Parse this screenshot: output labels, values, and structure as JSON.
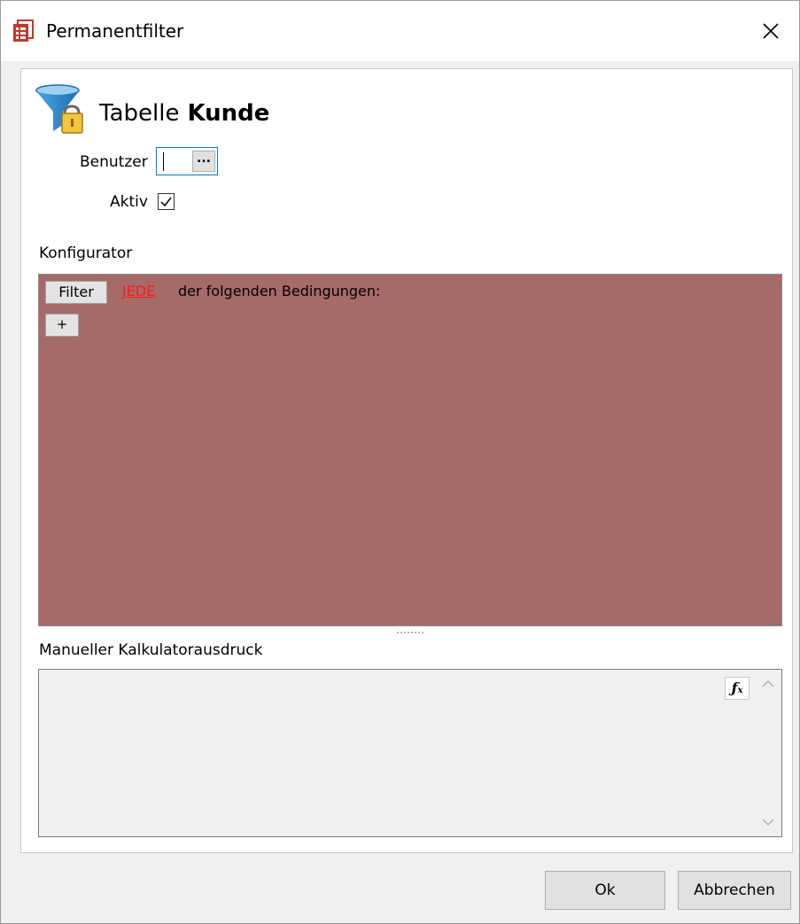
{
  "window": {
    "title": "Permanentfilter",
    "icon": "document-stack-icon",
    "close_icon": "close-icon"
  },
  "header": {
    "icon": "funnel-lock-icon",
    "table_label": "Tabelle",
    "table_name": "Kunde"
  },
  "form": {
    "user_label": "Benutzer",
    "user_value": "",
    "browse_label": "...",
    "active_label": "Aktiv",
    "active_checked": true
  },
  "configurator": {
    "heading": "Konfigurator",
    "filter_button": "Filter",
    "quantifier_link": "JEDE",
    "condition_text": "der folgenden Bedingungen:",
    "add_button": "+",
    "background_color": "#a66a68",
    "link_color": "#ff1a1a"
  },
  "expression": {
    "heading": "Manueller Kalkulatorausdruck",
    "value": "",
    "function_icon": "function-fx-icon"
  },
  "buttons": {
    "ok": "Ok",
    "cancel": "Abbrechen"
  }
}
